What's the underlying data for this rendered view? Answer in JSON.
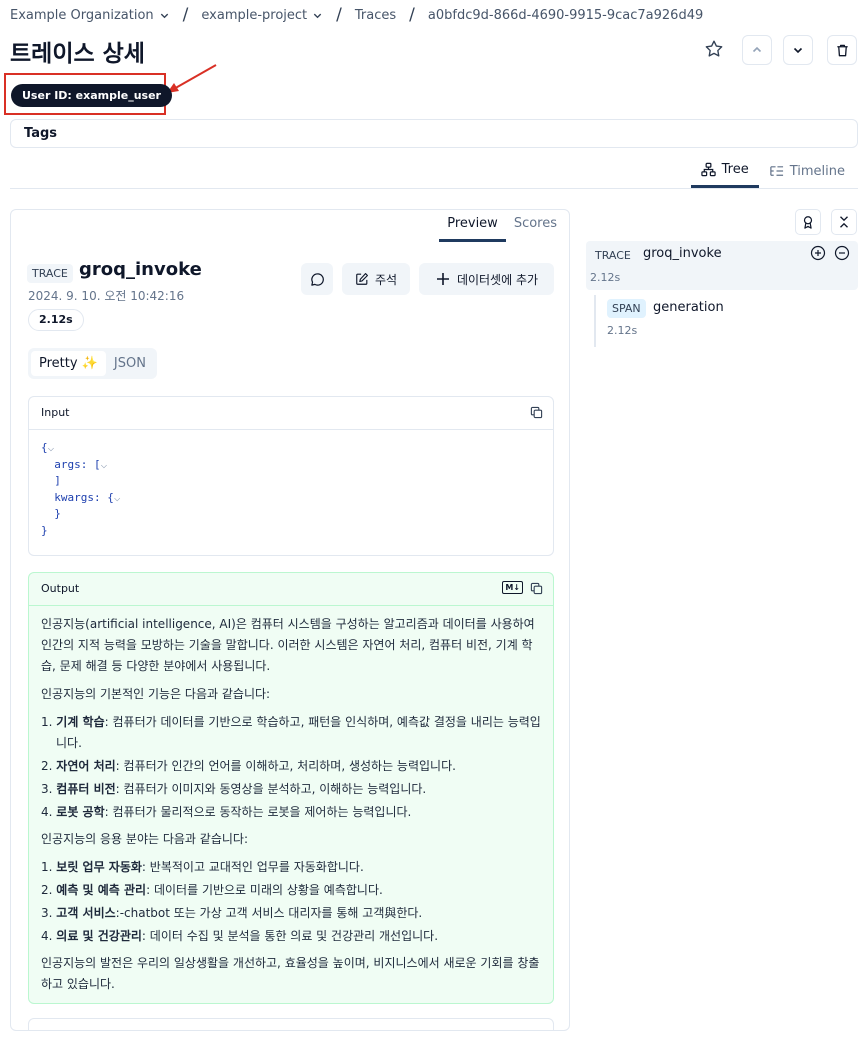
{
  "breadcrumb": {
    "org": "Example Organization",
    "project": "example-project",
    "section": "Traces",
    "trace_id": "a0bfdc9d-866d-4690-9915-9cac7a926d49"
  },
  "page": {
    "title": "트레이스 상세"
  },
  "user_badge": "User ID: example_user",
  "tags_label": "Tags",
  "view_tabs": {
    "tree": "Tree",
    "timeline": "Timeline",
    "active": "Tree"
  },
  "panel": {
    "tabs": {
      "preview": "Preview",
      "scores": "Scores",
      "active": "Preview"
    },
    "type_pill": "TRACE",
    "name": "groq_invoke",
    "timestamp": "2024. 9. 10. 오전 10:42:16",
    "duration": "2.12s",
    "actions": {
      "annotate": "주석",
      "add_dataset": "데이터셋에 추가"
    },
    "format_toggle": {
      "pretty": "Pretty ✨",
      "json": "JSON",
      "active": "Pretty"
    },
    "input": {
      "label": "Input",
      "lines": [
        "{",
        "args: [",
        "]",
        "kwargs: {",
        "}",
        "}"
      ]
    },
    "output": {
      "label": "Output",
      "md_badge": "M↓",
      "intro": "인공지능(artificial intelligence, AI)은 컴퓨터 시스템을 구성하는 알고리즘과 데이터를 사용하여 인간의 지적 능력을 모방하는 기술을 말합니다. 이러한 시스템은 자연어 처리, 컴퓨터 비전, 기계 학습, 문제 해결 등 다양한 분야에서 사용됩니다.",
      "functions_heading": "인공지능의 기본적인 기능은 다음과 같습니다:",
      "functions": [
        {
          "num": "1.",
          "term": "기계 학습",
          "desc": ": 컴퓨터가 데이터를 기반으로 학습하고, 패턴을 인식하며, 예측값 결정을 내리는 능력입니다."
        },
        {
          "num": "2.",
          "term": "자연어 처리",
          "desc": ": 컴퓨터가 인간의 언어를 이해하고, 처리하며, 생성하는 능력입니다."
        },
        {
          "num": "3.",
          "term": "컴퓨터 비전",
          "desc": ": 컴퓨터가 이미지와 동영상을 분석하고, 이해하는 능력입니다."
        },
        {
          "num": "4.",
          "term": "로봇 공학",
          "desc": ": 컴퓨터가 물리적으로 동작하는 로봇을 제어하는 능력입니다."
        }
      ],
      "applications_heading": "인공지능의 응용 분야는 다음과 같습니다:",
      "applications": [
        {
          "num": "1.",
          "term": "보릿 업무 자동화",
          "desc": ": 반복적이고 교대적인 업무를 자동화합니다."
        },
        {
          "num": "2.",
          "term": "예측 및 예측 관리",
          "desc": ": 데이터를 기반으로 미래의 상황을 예측합니다."
        },
        {
          "num": "3.",
          "term": "고객 서비스",
          "desc": ":-chatbot 또는 가상 고객 서비스 대리자를 통해 고객與한다."
        },
        {
          "num": "4.",
          "term": "의료 및 건강관리",
          "desc": ": 데이터 수집 및 분석을 통한 의료 및 건강관리 개선입니다."
        }
      ],
      "conclusion": "인공지능의 발전은 우리의 일상생활을 개선하고, 효율성을 높이며, 비지니스에서 새로운 기회를 창출하고 있습니다."
    }
  },
  "tree": {
    "nodes": [
      {
        "type": "TRACE",
        "name": "groq_invoke",
        "duration": "2.12s"
      },
      {
        "type": "SPAN",
        "name": "generation",
        "duration": "2.12s"
      }
    ]
  },
  "colors": {
    "accent": "#1f3a5f",
    "badge_bg": "#0f172a",
    "output_bg": "#f0fdf4",
    "annotation": "#d93025"
  }
}
